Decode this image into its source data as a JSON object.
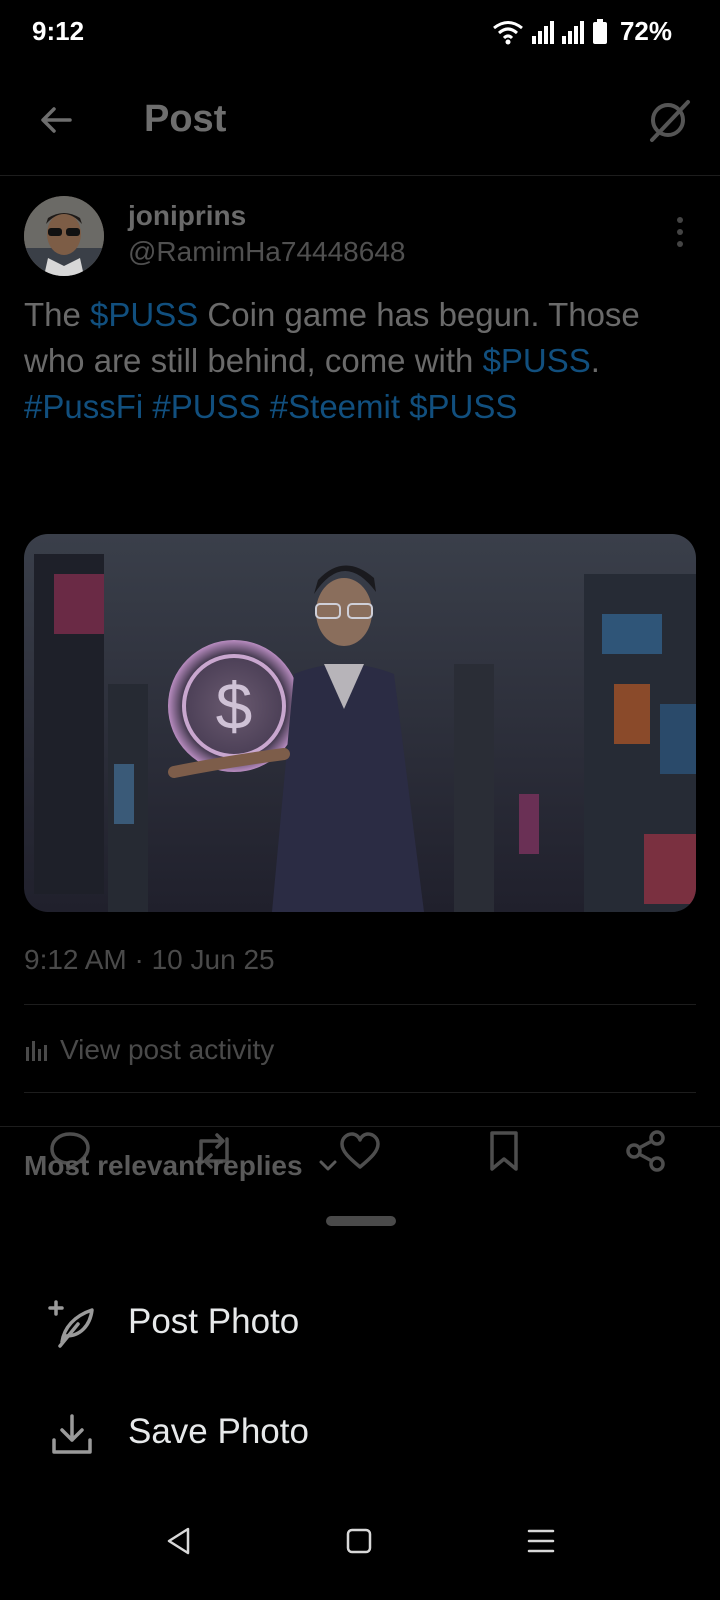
{
  "status": {
    "time": "9:12",
    "battery": "72%"
  },
  "header": {
    "title": "Post",
    "back_icon": "arrow-left-icon",
    "grok_icon": "grok-icon"
  },
  "post": {
    "author_name": "joniprins",
    "author_handle": "@RamimHa74448648",
    "text_parts": [
      {
        "text": "The ",
        "link": false
      },
      {
        "text": "$PUSS",
        "link": true
      },
      {
        "text": " Coin game has begun. Those who are still behind, come with ",
        "link": false
      },
      {
        "text": "$PUSS",
        "link": true
      },
      {
        "text": ". ",
        "link": false
      },
      {
        "text": "#PussFi",
        "link": true
      },
      {
        "text": " ",
        "link": false
      },
      {
        "text": "#PUSS",
        "link": true
      },
      {
        "text": " ",
        "link": false
      },
      {
        "text": "#Steemit",
        "link": true
      },
      {
        "text": " ",
        "link": false
      },
      {
        "text": "$PUSS",
        "link": true
      }
    ],
    "timestamp": "9:12 AM · 10 Jun 25",
    "activity_label": "View post activity"
  },
  "actions": [
    "reply-icon",
    "repost-icon",
    "like-icon",
    "bookmark-icon",
    "share-icon"
  ],
  "replies": {
    "sort_label": "Most relevant replies"
  },
  "sheet": {
    "items": [
      {
        "label": "Post Photo",
        "icon": "feather-plus-icon"
      },
      {
        "label": "Save Photo",
        "icon": "download-icon"
      }
    ]
  },
  "colors": {
    "link": "#1d9bf0",
    "background": "#000000",
    "text": "#e7e9ea"
  }
}
